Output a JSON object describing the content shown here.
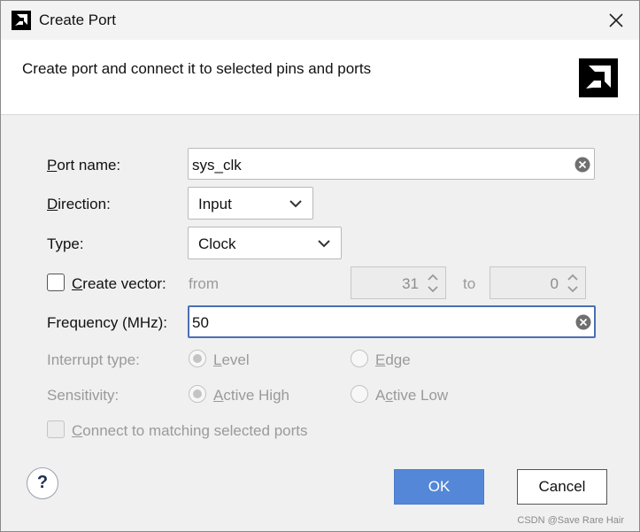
{
  "window": {
    "title": "Create Port",
    "close_icon": "close-icon",
    "app_icon": "amd-logo-icon"
  },
  "banner": {
    "description": "Create port and connect it to selected pins and ports",
    "logo": "amd-logo-icon"
  },
  "form": {
    "port_name": {
      "label_mnemonic": "P",
      "label_rest": "ort name:",
      "value": "sys_clk"
    },
    "direction": {
      "label_mnemonic": "D",
      "label_rest": "irection:",
      "value": "Input"
    },
    "type": {
      "label": "Type:",
      "value": "Clock"
    },
    "create_vector": {
      "label_mnemonic": "C",
      "label_rest": "reate vector:",
      "checked": false,
      "from_label": "from",
      "from_value": "31",
      "to_label": "to",
      "to_value": "0"
    },
    "frequency": {
      "label": "Frequency (MHz):",
      "value": "50"
    },
    "interrupt_type": {
      "label": "Interrupt type:",
      "option_level_mnemonic": "L",
      "option_level_rest": "evel",
      "option_edge_mnemonic": "E",
      "option_edge_rest": "dge",
      "selected": "Level"
    },
    "sensitivity": {
      "label": "Sensitivity:",
      "option_high_mnemonic": "A",
      "option_high_rest": "ctive High",
      "option_low_pre": "A",
      "option_low_mnemonic": "c",
      "option_low_rest": "tive Low",
      "selected": "Active High"
    },
    "connect_matching": {
      "label_mnemonic": "C",
      "label_rest": "onnect to matching selected ports",
      "checked": false
    }
  },
  "footer": {
    "help_label": "?",
    "ok_label": "OK",
    "cancel_label": "Cancel"
  },
  "watermark": "CSDN @Save Rare Hair",
  "colors": {
    "ok_button": "#5487d8",
    "focus_border": "#4a6fb5",
    "disabled_text": "#9a9a9a"
  }
}
